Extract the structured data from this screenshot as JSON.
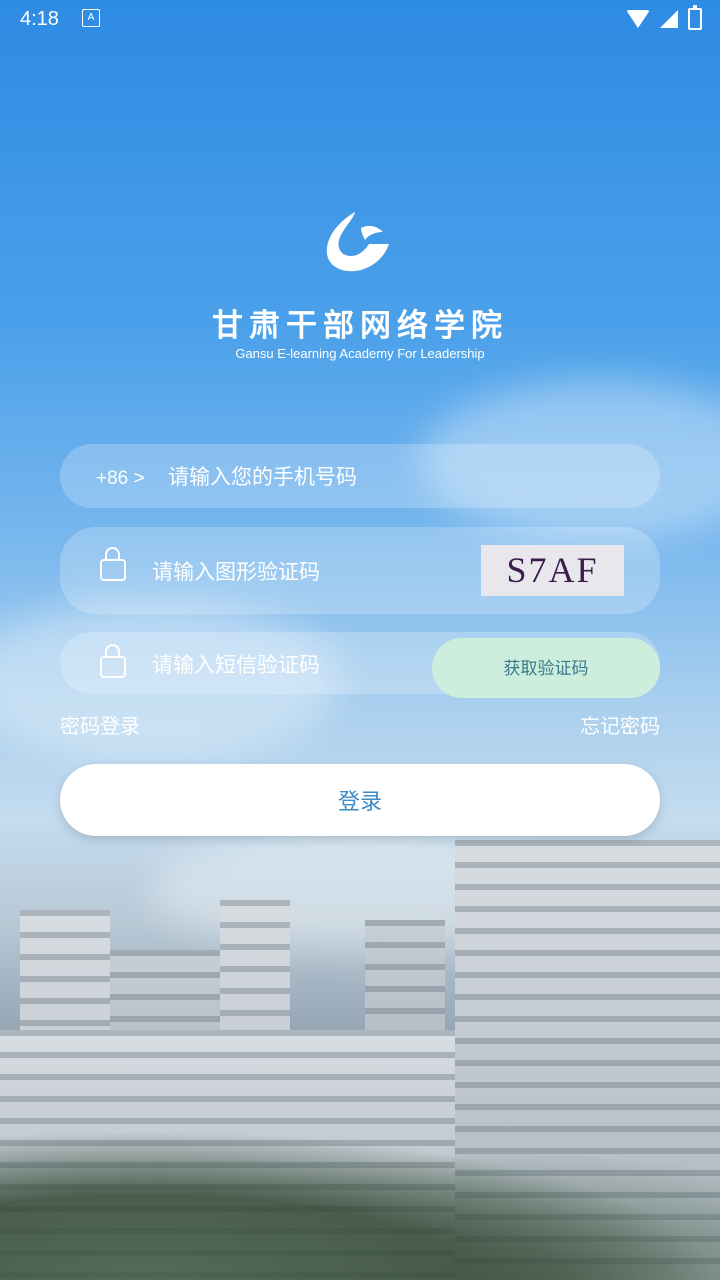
{
  "status_bar": {
    "time": "4:18",
    "app_badge": "A"
  },
  "brand": {
    "name_cn": "甘肃干部网络学院",
    "name_en": "Gansu E-learning Academy For Leadership"
  },
  "login_form": {
    "country_code": "+86 >",
    "phone_placeholder": "请输入您的手机号码",
    "captcha_placeholder": "请输入图形验证码",
    "captcha_text": "S7AF",
    "sms_placeholder": "请输入短信验证码",
    "get_code_label": "获取验证码",
    "password_login_label": "密码登录",
    "forgot_password_label": "忘记密码",
    "login_label": "登录"
  },
  "colors": {
    "accent": "#3b8cc7",
    "sms_button_bg": "#cdeedd"
  }
}
